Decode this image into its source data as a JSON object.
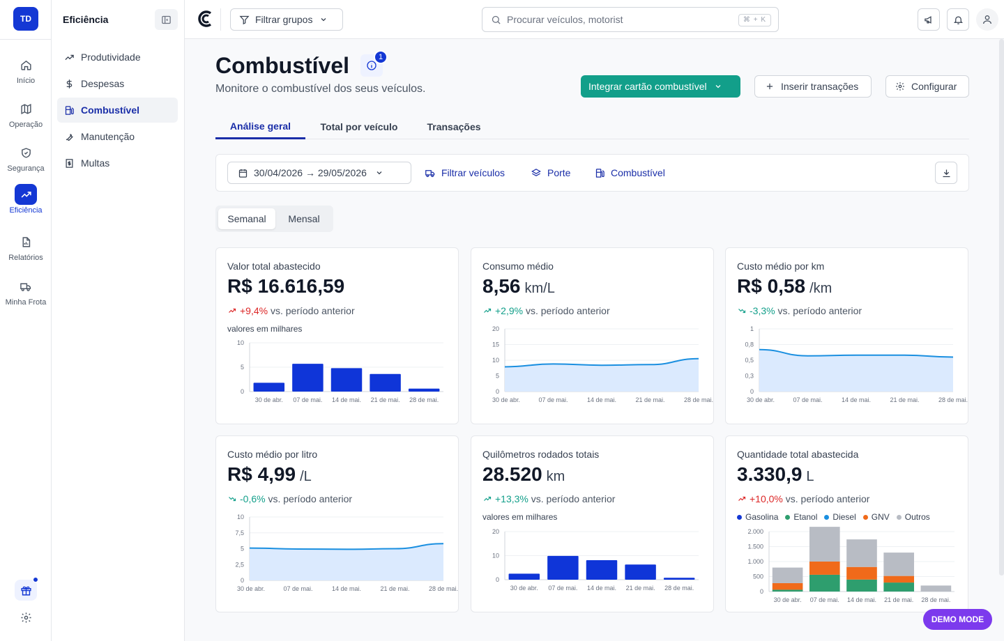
{
  "rail": {
    "logo": "TD",
    "items": [
      {
        "label": "Início",
        "icon": "home-icon"
      },
      {
        "label": "Operação",
        "icon": "map-icon"
      },
      {
        "label": "Segurança",
        "icon": "shield-icon"
      },
      {
        "label": "Eficiência",
        "icon": "trending-up-icon"
      },
      {
        "label": "Relatórios",
        "icon": "report-icon"
      },
      {
        "label": "Minha Frota",
        "icon": "truck-icon"
      }
    ]
  },
  "subnav": {
    "title": "Eficiência",
    "items": [
      {
        "label": "Produtividade",
        "icon": "trend-icon"
      },
      {
        "label": "Despesas",
        "icon": "dollar-icon"
      },
      {
        "label": "Combustível",
        "icon": "fuel-pump-icon"
      },
      {
        "label": "Manutenção",
        "icon": "wrench-icon"
      },
      {
        "label": "Multas",
        "icon": "receipt-icon"
      }
    ]
  },
  "topbar": {
    "filter_label": "Filtrar grupos",
    "search_placeholder": "Procurar veículos, motorist",
    "search_shortcut": "⌘ + K"
  },
  "header": {
    "title": "Combustível",
    "badge": "1",
    "subtitle": "Monitore o combustível dos seus veículos.",
    "btn_integrate": "Integrar cartão combustível",
    "btn_insert": "Inserir transações",
    "btn_configure": "Configurar"
  },
  "tabs": [
    "Análise geral",
    "Total por veículo",
    "Transações"
  ],
  "filters": {
    "date_range": "30/04/2026 → 29/05/2026",
    "vehicles": "Filtrar veículos",
    "porte": "Porte",
    "fuel": "Combustível"
  },
  "period": {
    "weekly": "Semanal",
    "monthly": "Mensal"
  },
  "cards": [
    {
      "title": "Valor total abastecido",
      "value": "R$ 16.616,59",
      "unit": "",
      "delta": "+9,4%",
      "delta_dir": "up",
      "delta_good": false,
      "delta_text": "vs. período anterior",
      "note": "valores em milhares",
      "chart": {
        "type": "bar",
        "categories": [
          "30 de abr.",
          "07 de mai.",
          "14 de mai.",
          "21 de mai.",
          "28 de mai."
        ],
        "values": [
          1.8,
          5.7,
          4.8,
          3.6,
          0.6
        ],
        "yticks": [
          "10",
          "5",
          "0"
        ],
        "ymax": 10,
        "color": "#0f35d8"
      }
    },
    {
      "title": "Consumo médio",
      "value": "8,56",
      "unit": "km/L",
      "delta": "+2,9%",
      "delta_dir": "up",
      "delta_good": true,
      "delta_text": "vs. período anterior",
      "note": "",
      "chart": {
        "type": "area",
        "categories": [
          "30 de abr.",
          "07 de mai.",
          "14 de mai.",
          "21 de mai.",
          "28 de mai."
        ],
        "values": [
          7.9,
          8.8,
          8.4,
          8.6,
          10.5
        ],
        "yticks": [
          "20",
          "15",
          "10",
          "5",
          "0"
        ],
        "ymax": 20,
        "color": "#1a8fe0"
      }
    },
    {
      "title": "Custo médio por km",
      "value": "R$ 0,58",
      "unit": "/km",
      "delta": "-3,3%",
      "delta_dir": "down",
      "delta_good": true,
      "delta_text": "vs. período anterior",
      "note": "",
      "chart": {
        "type": "area",
        "categories": [
          "30 de abr.",
          "07 de mai.",
          "14 de mai.",
          "21 de mai.",
          "28 de mai."
        ],
        "values": [
          0.67,
          0.57,
          0.58,
          0.58,
          0.55
        ],
        "yticks": [
          "1",
          "0,8",
          "0,5",
          "0,3",
          "0"
        ],
        "ymax": 1,
        "color": "#1a8fe0"
      }
    },
    {
      "title": "Custo médio por litro",
      "value": "R$ 4,99",
      "unit": "/L",
      "delta": "-0,6%",
      "delta_dir": "down",
      "delta_good": true,
      "delta_text": "vs. período anterior",
      "note": "",
      "chart": {
        "type": "area",
        "categories": [
          "30 de abr.",
          "07 de mai.",
          "14 de mai.",
          "21 de mai.",
          "28 de mai."
        ],
        "values": [
          5.1,
          4.95,
          4.9,
          5.0,
          5.8
        ],
        "yticks": [
          "10",
          "7,5",
          "5",
          "2,5",
          "0"
        ],
        "ymax": 10,
        "color": "#1a8fe0"
      }
    },
    {
      "title": "Quilômetros rodados totais",
      "value": "28.520",
      "unit": "km",
      "delta": "+13,3%",
      "delta_dir": "up",
      "delta_good": true,
      "delta_text": "vs. período anterior",
      "note": "valores em milhares",
      "chart": {
        "type": "bar",
        "categories": [
          "30 de abr.",
          "07 de mai.",
          "14 de mai.",
          "21 de mai.",
          "28 de mai."
        ],
        "values": [
          2.5,
          9.9,
          8.1,
          6.3,
          0.8
        ],
        "yticks": [
          "20",
          "10",
          "0"
        ],
        "ymax": 20,
        "color": "#0f35d8"
      }
    },
    {
      "title": "Quantidade total abastecida",
      "value": "3.330,9",
      "unit": "L",
      "delta": "+10,0%",
      "delta_dir": "up",
      "delta_good": false,
      "delta_text": "vs. período anterior",
      "note": "",
      "legend": [
        {
          "name": "Gasolina",
          "color": "#1438d4"
        },
        {
          "name": "Etanol",
          "color": "#2e9e6e"
        },
        {
          "name": "Diesel",
          "color": "#1a8fe0"
        },
        {
          "name": "GNV",
          "color": "#f06a1a"
        },
        {
          "name": "Outros",
          "color": "#b8bcc4"
        }
      ],
      "chart": {
        "type": "stacked",
        "categories": [
          "30 de abr.",
          "07 de mai.",
          "14 de mai.",
          "21 de mai.",
          "28 de mai."
        ],
        "series": [
          {
            "name": "Gasolina",
            "color": "#1438d4",
            "values": [
              0,
              0,
              0,
              0,
              0
            ]
          },
          {
            "name": "Etanol",
            "color": "#2e9e6e",
            "values": [
              60,
              560,
              400,
              300,
              0
            ]
          },
          {
            "name": "Diesel",
            "color": "#1a8fe0",
            "values": [
              0,
              0,
              0,
              0,
              0
            ]
          },
          {
            "name": "GNV",
            "color": "#f06a1a",
            "values": [
              220,
              440,
              420,
              220,
              0
            ]
          },
          {
            "name": "Outros",
            "color": "#b8bcc4",
            "values": [
              520,
              1160,
              920,
              780,
              200
            ]
          }
        ],
        "yticks": [
          "2.000",
          "1.500",
          "1.000",
          "500",
          "0"
        ],
        "ymax": 2000
      }
    }
  ],
  "demo_mode": "DEMO MODE"
}
